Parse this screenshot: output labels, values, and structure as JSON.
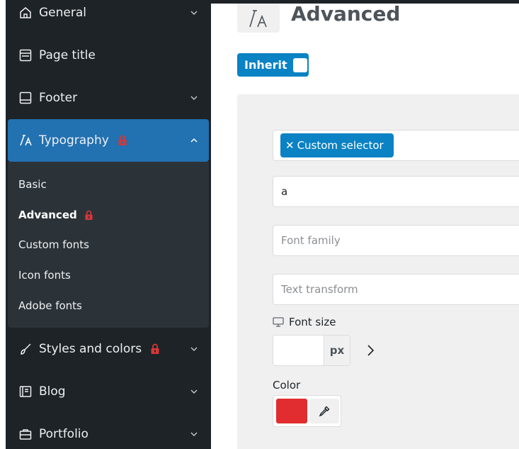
{
  "sidebar": {
    "items": [
      {
        "label": "General",
        "icon": "home-icon"
      },
      {
        "label": "Page title",
        "icon": "page-title-icon"
      },
      {
        "label": "Footer",
        "icon": "footer-icon"
      },
      {
        "label": "Typography",
        "icon": "typography-icon"
      },
      {
        "label": "Styles and colors",
        "icon": "brush-icon"
      },
      {
        "label": "Blog",
        "icon": "blog-icon"
      },
      {
        "label": "Portfolio",
        "icon": "briefcase-icon"
      }
    ],
    "typography_submenu": [
      {
        "label": "Basic"
      },
      {
        "label": "Advanced"
      },
      {
        "label": "Custom fonts"
      },
      {
        "label": "Icon fonts"
      },
      {
        "label": "Adobe fonts"
      }
    ]
  },
  "header": {
    "title": "Advanced",
    "icon": "typography-icon"
  },
  "inherit": {
    "label": "Inherit"
  },
  "form": {
    "selector_chip": "Custom selector",
    "selector_value": "a",
    "font_family_placeholder": "Font family",
    "text_transform_placeholder": "Text transform",
    "font_size_label": "Font size",
    "font_size_value": "",
    "font_size_unit": "px",
    "color_label": "Color",
    "color_value": "#e12d2f"
  },
  "colors": {
    "sidebar_bg": "#1d2327",
    "submenu_bg": "#2c3338",
    "accent": "#2271b1",
    "button_blue": "#0a82c4",
    "lock_red": "#d63638"
  }
}
